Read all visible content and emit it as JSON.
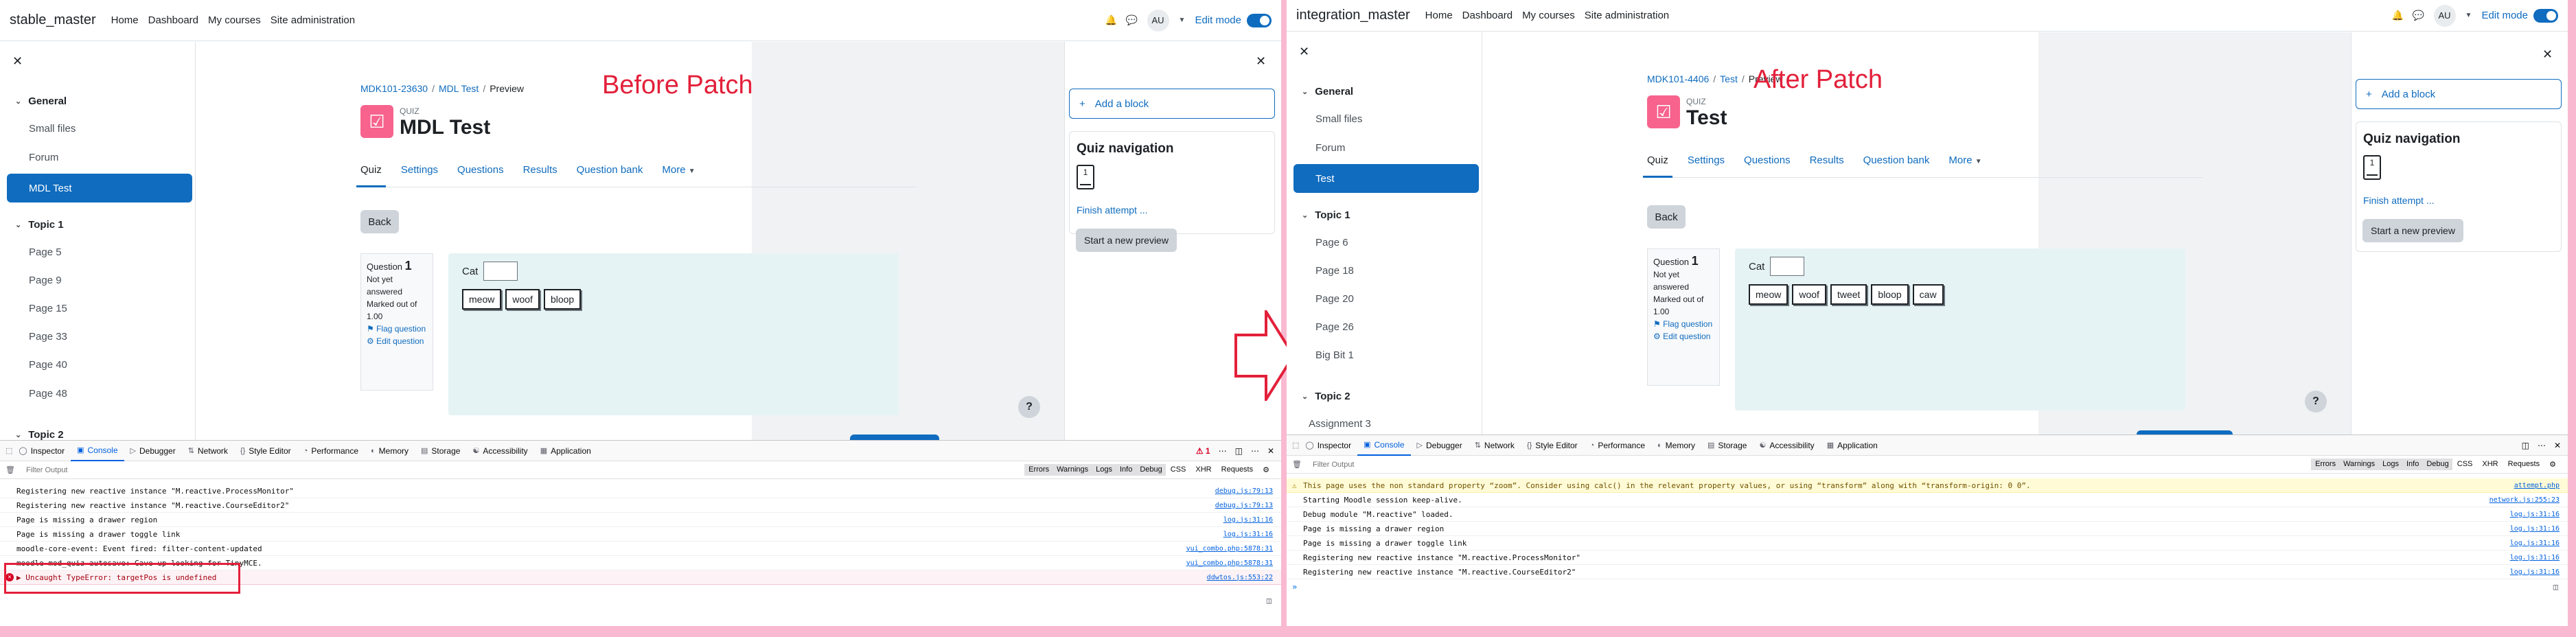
{
  "colors": {
    "accent": "#0f6cbf",
    "quiz_icon": "#f7638d",
    "annotation": "#e3203a",
    "frame": "#f9b9d1"
  },
  "nav": {
    "links": [
      "Home",
      "Dashboard",
      "My courses",
      "Site administration"
    ],
    "avatar": "AU",
    "edit_mode": "Edit mode"
  },
  "left": {
    "site_name": "stable_master",
    "annotation": "Before Patch",
    "course_index": {
      "general": "General",
      "items": [
        "Small files",
        "Forum"
      ],
      "active": "MDL Test",
      "topic1": "Topic 1",
      "topic1_items": [
        "Page 5",
        "Page 9",
        "Page 15",
        "Page 33",
        "Page 40",
        "Page 48"
      ],
      "topic2": "Topic 2"
    },
    "breadcrumb": [
      "MDK101-23630",
      "MDL Test",
      "Preview"
    ],
    "quiz_kind": "QUIZ",
    "page_title": "MDL Test",
    "choices": [
      "meow",
      "woof",
      "bloop"
    ]
  },
  "right": {
    "site_name": "integration_master",
    "annotation": "After Patch",
    "course_index": {
      "general": "General",
      "items": [
        "Small files",
        "Forum"
      ],
      "active": "Test",
      "topic1": "Topic 1",
      "topic1_items": [
        "Page 6",
        "Page 18",
        "Page 20",
        "Page 26",
        "Big Bit 1"
      ],
      "topic2": "Topic 2",
      "topic2_items": [
        "Assignment 3"
      ]
    },
    "breadcrumb": [
      "MDK101-4406",
      "Test",
      "Preview"
    ],
    "quiz_kind": "QUIZ",
    "page_title": "Test",
    "choices": [
      "meow",
      "woof",
      "tweet",
      "bloop",
      "caw"
    ]
  },
  "tabs": [
    "Quiz",
    "Settings",
    "Questions",
    "Results",
    "Question bank",
    "More"
  ],
  "back": "Back",
  "question": {
    "label": "Question",
    "number": "1",
    "status": "Not yet answered",
    "marked": "Marked out of 1.00",
    "flag": "Flag question",
    "edit": "Edit question",
    "prompt": "Cat"
  },
  "blocks": {
    "add_block": "Add a block",
    "nav_title": "Quiz navigation",
    "nav_btn": "1",
    "finish": "Finish attempt ...",
    "new_preview": "Start a new preview"
  },
  "devtools": {
    "tabs": [
      "Inspector",
      "Console",
      "Debugger",
      "Network",
      "Style Editor",
      "Performance",
      "Memory",
      "Storage",
      "Accessibility",
      "Application"
    ],
    "filter_placeholder": "Filter Output",
    "filters": [
      "Errors",
      "Warnings",
      "Logs",
      "Info",
      "Debug",
      "CSS",
      "XHR",
      "Requests"
    ],
    "left_error_count": "1",
    "left_logs": [
      {
        "text": "Registering new reactive instance \"M.reactive.ProcessMonitor\"",
        "src": "debug.js:79:13"
      },
      {
        "text": "Registering new reactive instance \"M.reactive.CourseEditor2\"",
        "src": "debug.js:79:13"
      },
      {
        "text": "Page is missing a drawer region",
        "src": "log.js:31:16"
      },
      {
        "text": "Page is missing a drawer toggle link",
        "src": "log.js:31:16"
      },
      {
        "text": "moodle-core-event: Event fired: filter-content-updated",
        "src": "yui_combo.php:5878:31"
      },
      {
        "text": "moodle-mod_quiz-autosave: Gave up looking for TinyMCE.",
        "src": "yui_combo.php:5878:31"
      }
    ],
    "left_error": {
      "text": "▶ Uncaught TypeError: targetPos is undefined",
      "src": "ddwtos.js:553:22"
    },
    "right_warning": {
      "text": "This page uses the non standard property “zoom”. Consider using calc() in the relevant property values, or using “transform” along with “transform-origin: 0 0”.",
      "src": "attempt.php"
    },
    "right_logs": [
      {
        "text": "Starting Moodle session keep-alive.",
        "src": "network.js:255:23"
      },
      {
        "text": "Debug module \"M.reactive\" loaded.",
        "src": "log.js:31:16"
      },
      {
        "text": "Page is missing a drawer region",
        "src": "log.js:31:16"
      },
      {
        "text": "Page is missing a drawer toggle link",
        "src": "log.js:31:16"
      },
      {
        "text": "Registering new reactive instance \"M.reactive.ProcessMonitor\"",
        "src": "log.js:31:16"
      },
      {
        "text": "Registering new reactive instance \"M.reactive.CourseEditor2\"",
        "src": "log.js:31:16"
      }
    ],
    "prompt": "»"
  }
}
